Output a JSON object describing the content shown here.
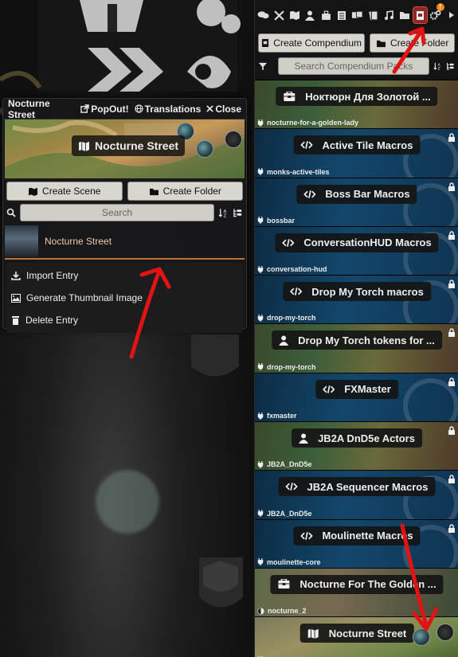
{
  "popout": {
    "title": "Nocturne Street",
    "popout_label": "PopOut!",
    "translations_label": "Translations",
    "close_label": "Close",
    "banner_label": "Nocturne Street",
    "create_scene_label": "Create Scene",
    "create_folder_label": "Create Folder",
    "search_placeholder": "Search",
    "entry_name": "Nocturne Street",
    "context_menu": [
      "Import Entry",
      "Generate Thumbnail Image",
      "Delete Entry"
    ]
  },
  "sidebar": {
    "tab_icons": [
      "chat-icon",
      "combat-icon",
      "scenes-icon",
      "actors-icon",
      "items-icon",
      "journal-icon",
      "tables-icon",
      "cards-icon",
      "playlists-icon",
      "compendium-icon",
      "settings-icon",
      "collapse-icon"
    ],
    "notification_badge": "!",
    "create_compendium_label": "Create Compendium",
    "create_folder_label": "Create Folder",
    "search_placeholder": "Search Compendium Packs",
    "packs": [
      {
        "label": "Ноктюрн Для Золотой ...",
        "source": "nocturne-for-a-golden-lady",
        "icon": "adventure-icon",
        "bg": "fantasy",
        "locked": false
      },
      {
        "label": "Active Tile Macros",
        "source": "monks-active-tiles",
        "icon": "code-icon",
        "bg": "blue",
        "locked": true
      },
      {
        "label": "Boss Bar Macros",
        "source": "bossbar",
        "icon": "code-icon",
        "bg": "blue",
        "locked": true
      },
      {
        "label": "ConversationHUD Macros",
        "source": "conversation-hud",
        "icon": "code-icon",
        "bg": "blue",
        "locked": true
      },
      {
        "label": "Drop My Torch macros",
        "source": "drop-my-torch",
        "icon": "code-icon",
        "bg": "blue",
        "locked": true
      },
      {
        "label": "Drop My Torch tokens for ...",
        "source": "drop-my-torch",
        "icon": "user-icon",
        "bg": "fantasy",
        "locked": true
      },
      {
        "label": "FXMaster",
        "source": "fxmaster",
        "icon": "code-icon",
        "bg": "blue",
        "locked": true
      },
      {
        "label": "JB2A DnD5e Actors",
        "source": "JB2A_DnD5e",
        "icon": "user-icon",
        "bg": "fantasy",
        "locked": true
      },
      {
        "label": "JB2A Sequencer Macros",
        "source": "JB2A_DnD5e",
        "icon": "code-icon",
        "bg": "blue",
        "locked": true
      },
      {
        "label": "Moulinette Macros",
        "source": "moulinette-core",
        "icon": "code-icon",
        "bg": "blue",
        "locked": true
      },
      {
        "label": "Nocturne For The Golden ...",
        "source": "nocturne_2",
        "icon": "adventure-icon",
        "bg": "golden",
        "locked": false
      },
      {
        "label": "Nocturne Street",
        "source": "nocturne-street",
        "icon": "map-icon",
        "bg": "scene",
        "locked": false
      }
    ]
  },
  "colors": {
    "accent": "#c0713a",
    "arrow": "#e01414",
    "button_bg": "#d8d6cf",
    "active_tab": "#8a2a2a"
  }
}
